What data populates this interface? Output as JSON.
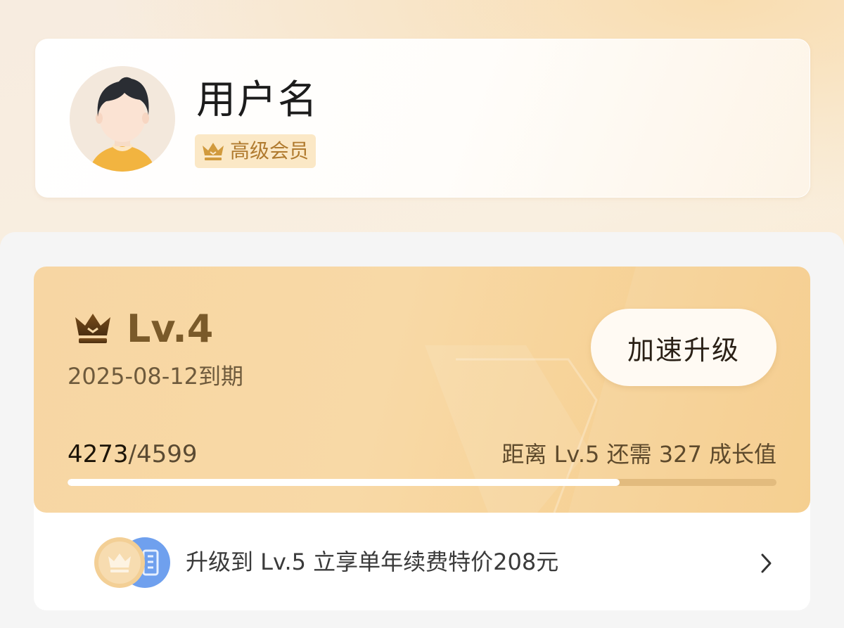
{
  "profile": {
    "username": "用户名",
    "membership_label": "高级会员"
  },
  "level_card": {
    "level_name": "Lv.4",
    "expiry": "2025-08-12到期",
    "boost_button_label": "加速升级",
    "progress": {
      "current": "4273",
      "separator": "/",
      "total": "4599",
      "fraction": 0.779
    },
    "remaining_text": "距离 Lv.5 还需 327 成长值"
  },
  "promo": {
    "text": "升级到 Lv.5 立享单年续费特价208元",
    "icons": [
      "crown-coin-icon",
      "coupon-icon"
    ]
  },
  "colors": {
    "accent_gold": "#b07a2e",
    "level_card_bg": "#f7d6a3",
    "level_text": "#7a5a2a",
    "progress_fill": "#ffffff"
  }
}
